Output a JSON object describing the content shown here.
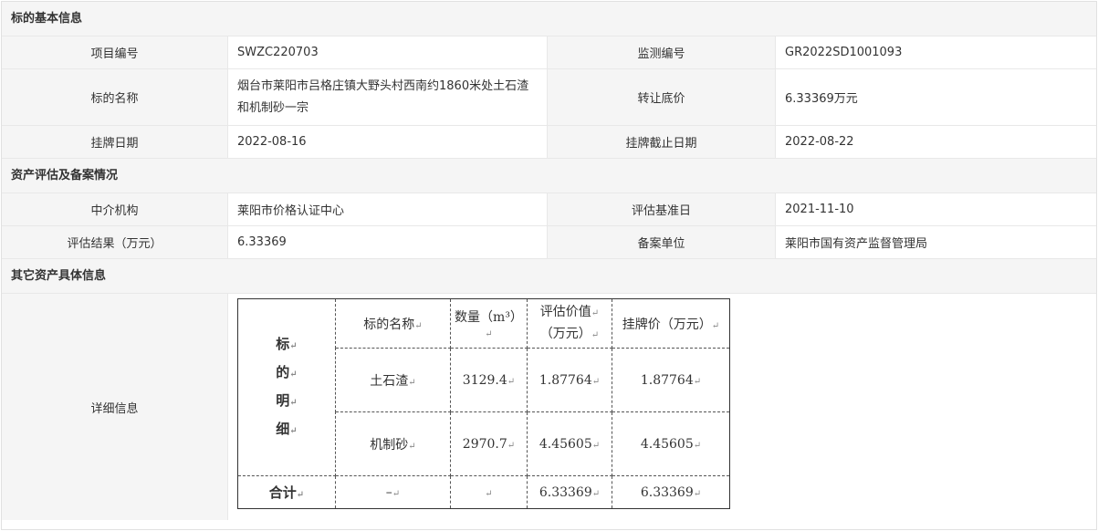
{
  "sections": {
    "basic": "标的基本信息",
    "assessment": "资产评估及备案情况",
    "other": "其它资产具体信息"
  },
  "basic": {
    "project_no_label": "项目编号",
    "project_no": "SWZC220703",
    "monitor_no_label": "监测编号",
    "monitor_no": "GR2022SD1001093",
    "name_label": "标的名称",
    "name_value": "烟台市莱阳市吕格庄镇大野头村西南约1860米处土石渣和机制砂一宗",
    "price_label": "转让底价",
    "price_value": "6.33369万元",
    "list_date_label": "挂牌日期",
    "list_date": "2022-08-16",
    "end_date_label": "挂牌截止日期",
    "end_date": "2022-08-22"
  },
  "assessment": {
    "agency_label": "中介机构",
    "agency": "莱阳市价格认证中心",
    "base_date_label": "评估基准日",
    "base_date": "2021-11-10",
    "result_label": "评估结果（万元）",
    "result": "6.33369",
    "filing_label": "备案单位",
    "filing": "莱阳市国有资产监督管理局"
  },
  "other": {
    "detail_label": "详细信息",
    "table": {
      "side_chars": [
        "标",
        "的",
        "明",
        "细"
      ],
      "headers": [
        "标的名称",
        "数量（m³）",
        "评估价值（万元）",
        "挂牌价（万元）"
      ],
      "header_value_line1": "评估价值",
      "header_value_line2": "（万元）",
      "rows": [
        {
          "name": "土石渣",
          "qty": "3129.4",
          "value": "1.87764",
          "price": "1.87764"
        },
        {
          "name": "机制砂",
          "qty": "2970.7",
          "value": "4.45605",
          "price": "4.45605"
        }
      ],
      "total": {
        "label": "合计",
        "name": "–",
        "qty": "",
        "value": "6.33369",
        "price": "6.33369"
      },
      "para_mark": "↵"
    }
  }
}
